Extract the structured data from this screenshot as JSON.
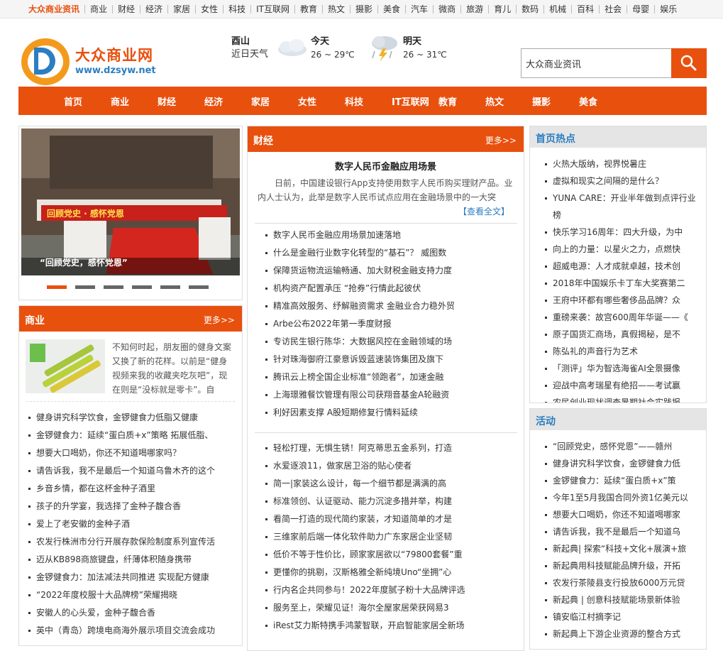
{
  "topbar": {
    "items": [
      "大众商业资讯",
      "商业",
      "财经",
      "经济",
      "家居",
      "女性",
      "科技",
      "IT互联网",
      "教育",
      "热文",
      "摄影",
      "美食",
      "汽车",
      "微商",
      "旅游",
      "育儿",
      "数码",
      "机械",
      "百科",
      "社会",
      "母婴",
      "娱乐"
    ]
  },
  "logo": {
    "name": "大众商业网",
    "url": "www.dzsyw.net"
  },
  "weather": {
    "city": "酉山",
    "recent": "近日天气",
    "today": {
      "label": "今天",
      "temp": "26 ~ 29℃"
    },
    "tomorrow": {
      "label": "明天",
      "temp": "26 ~ 31℃"
    }
  },
  "search": {
    "value": "大众商业资讯",
    "icon": "search-icon"
  },
  "nav": {
    "items": [
      "首页",
      "商业",
      "财经",
      "经济",
      "家居",
      "女性",
      "科技",
      "IT互联网",
      "教育",
      "热文",
      "摄影",
      "美食"
    ]
  },
  "slide": {
    "caption": "“回顾党史，感怀党恩”",
    "banner_text": "回顾党史 · 感怀党恩",
    "dots_active": 0,
    "dots_count": 6
  },
  "business": {
    "title": "商业",
    "more": "更多>>",
    "feature_text": "不知何时起，朋友圈的健身文案又换了新的花样。以前是“健身视频来我的收藏夹吃灰吧”，现在则是“没标就是零卡”。自",
    "items": [
      "健身讲究科学饮食，金锣健食力低脂又健康",
      "金锣健食力：延续“蛋白质+x”策略 拓展低脂、",
      "想要大口喝奶，你还不知道喝哪家吗？",
      "请告诉我，我不是最后一个知道乌鲁木齐的这个",
      "乡音乡情，都在这杯金种子酒里",
      "孩子的升学宴，我选择了金种子馥合香",
      "爱上了老安徽的金种子酒",
      "农发行株洲市分行开展存款保险制度系列宣传活",
      "迈从KB898商旅键盘，纤薄体积随身携带",
      "金锣健食力：加法减法共同推进 实现配方健康",
      "“2022年度校服十大品牌榜”荣耀揭晓",
      "安徽人的心头爱，金种子馥合香",
      "英中（青岛）跨境电商海外展示项目交流会成功"
    ]
  },
  "finance": {
    "title": "财经",
    "more": "更多>>",
    "headline": "数字人民币金融应用场景",
    "summary": "日前，中国建设银行App支持使用数字人民币购买理财产品。业内人士认为，此举是数字人民币试点应用在金融场景中的一大突",
    "read_more": "【查看全文】",
    "items1": [
      "数字人民币金融应用场景加速落地",
      "什么是金融行业数字化转型的“基石”？ 威图数",
      "保障货运物流运输畅通、加大财税金融支持力度",
      "机构资产配置承压 “抢券”行情此起彼伏",
      "精准高效服务、纾解融资需求 金融业合力稳外贸",
      "Arbe公布2022年第一季度财报",
      "专访民生银行陈华：大数据风控在金融领域的场",
      "针对珠海御府江豪意诉毁蓝速装饰集团及旗下",
      "腾讯云上榜全国企业标准“领跑者”，加速金融",
      "上海璟雅餐饮管理有限公司获翔音基金A轮融资",
      "利好因素支撑 A股短期修复行情料延续"
    ],
    "items2": [
      "轻松打理，无惧生锈！阿克蒂思五金系列，打造",
      "水爱逐浪11，做家居卫浴的贴心使者",
      "简一|家装这么设计，每一个细节都是满满的高",
      "标准领创、认证驱动、能力沉淀多措并举，构建",
      "看简一打造的现代简约家装，才知道简单的才是",
      "三维家前后端一体化软件助力广东家居企业坚韧",
      "低价不等于性价比，顾家家居欲以“79800套餐”重",
      "更懂你的挑剔，汉斯格雅全新纯境Uno“坐拥”心",
      "行内名企共同参与！2022年度腻子粉十大品牌评选",
      "服务至上，荣耀见证！海尔全屋家居荣获网易3",
      "iRest艾力斯特携手鸿蒙智联，开启智能家居全新场"
    ]
  },
  "hot": {
    "title": "首页热点",
    "items": [
      "火热大版纳，视界悦暑庄",
      "虚拟和现实之间隔的是什么？",
      "YUNA CARE：开业半年做到点评行业榜",
      "快乐学习16周年：四大升级，为中",
      "向上的力量：以星火之力，点燃快",
      "超威电源：人才成就卓越，技术创",
      "2018年中国娱乐卡丁车大奖赛第二",
      "王府中环都有哪些奢侈品品牌？众",
      "重磅来袭：故宫600周年华诞——《",
      "原子国货汇商场，真假揭秘，是不",
      "陈弘礼的声音行为艺术",
      "「测评」华为智选海雀AI全景摄像",
      "迎战中高考瑞星有绝招——考试赢",
      "农民创业现状调查暑期社会实践报"
    ]
  },
  "activity": {
    "title": "活动",
    "items": [
      "“回顾党史，感怀党恩”——赣州",
      "健身讲究科学饮食，金锣健食力低",
      "金锣健食力：延续“蛋白质+x”策",
      "今年1至5月我国合同外资1亿美元以",
      "想要大口喝奶，你还不知道喝哪家",
      "请告诉我，我不是最后一个知道乌",
      "新起典| 探索“科技+文化+展演+旅",
      "新起典用科技赋能品牌升级，开拓",
      "农发行茶陵县支行投放6000万元贷",
      "新起典 | 创意科技赋能场景新体验",
      "镇安临江村摘李记",
      "新起典上下游企业资源的整合方式"
    ]
  },
  "colors": {
    "accent": "#e8500e",
    "link": "#2c7ec1",
    "bg_gray": "#f5f5f5"
  }
}
